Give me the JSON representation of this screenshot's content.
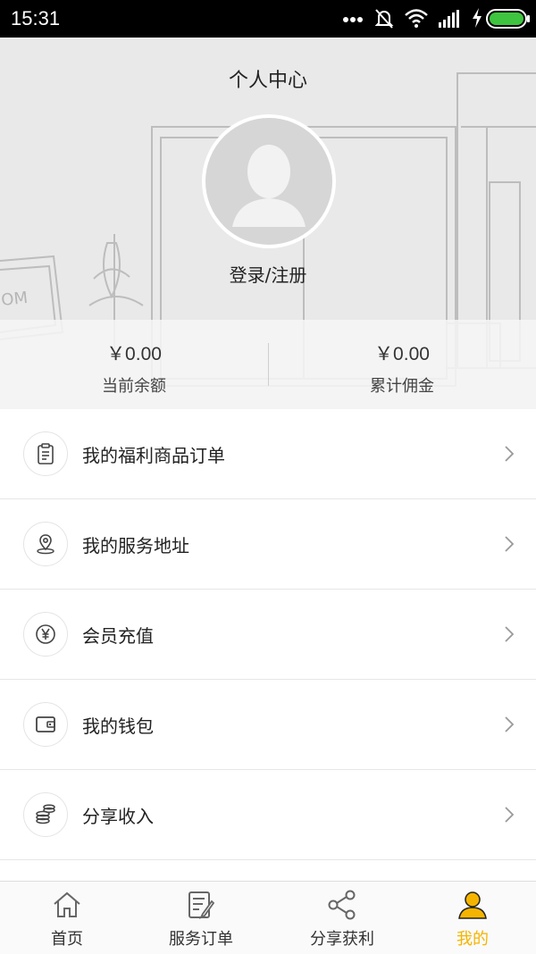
{
  "status_bar": {
    "time": "15:31"
  },
  "header": {
    "title": "个人中心",
    "login_link": "登录/注册",
    "stats": [
      {
        "amount": "￥0.00",
        "label": "当前余额"
      },
      {
        "amount": "￥0.00",
        "label": "累计佣金"
      }
    ]
  },
  "menu": {
    "items": [
      {
        "label": "我的福利商品订单",
        "icon": "clipboard-icon"
      },
      {
        "label": "我的服务地址",
        "icon": "location-pin-icon"
      },
      {
        "label": "会员充值",
        "icon": "yen-coin-icon"
      },
      {
        "label": "我的钱包",
        "icon": "wallet-icon"
      },
      {
        "label": "分享收入",
        "icon": "coins-stack-icon"
      }
    ]
  },
  "bottom_nav": {
    "items": [
      {
        "label": "首页",
        "icon": "home-icon",
        "active": false
      },
      {
        "label": "服务订单",
        "icon": "edit-doc-icon",
        "active": false
      },
      {
        "label": "分享获利",
        "icon": "share-icon",
        "active": false
      },
      {
        "label": "我的",
        "icon": "user-icon",
        "active": true
      }
    ],
    "active_color": "#f5b400"
  }
}
